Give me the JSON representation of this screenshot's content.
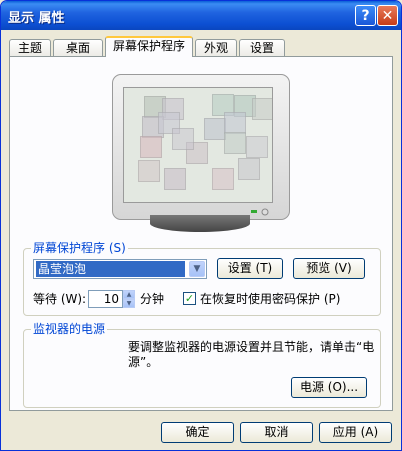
{
  "window": {
    "title": "显示 属性",
    "help_label": "?",
    "close_label": "✕"
  },
  "tabs": [
    {
      "label": "主题"
    },
    {
      "label": "桌面"
    },
    {
      "label": "屏幕保护程序"
    },
    {
      "label": "外观"
    },
    {
      "label": "设置"
    }
  ],
  "active_tab": 2,
  "screensaver": {
    "group_label": "屏幕保护程序 (S)",
    "selected": "晶莹泡泡",
    "settings_button": "设置 (T)",
    "preview_button": "预览 (V)",
    "wait_label": "等待 (W):",
    "wait_value": "10",
    "minutes_label": "分钟",
    "password_checkbox_label": "在恢复时使用密码保护 (P)",
    "password_checked": true
  },
  "power": {
    "group_label": "监视器的电源",
    "description": "要调整监视器的电源设置并且节能，请单击“电源”。",
    "power_button": "电源 (O)..."
  },
  "footer": {
    "ok": "确定",
    "cancel": "取消",
    "apply": "应用 (A)"
  },
  "colors": {
    "titlebar": "#0a4fd2",
    "selection": "#316ac5",
    "group_label": "#0046d5"
  }
}
